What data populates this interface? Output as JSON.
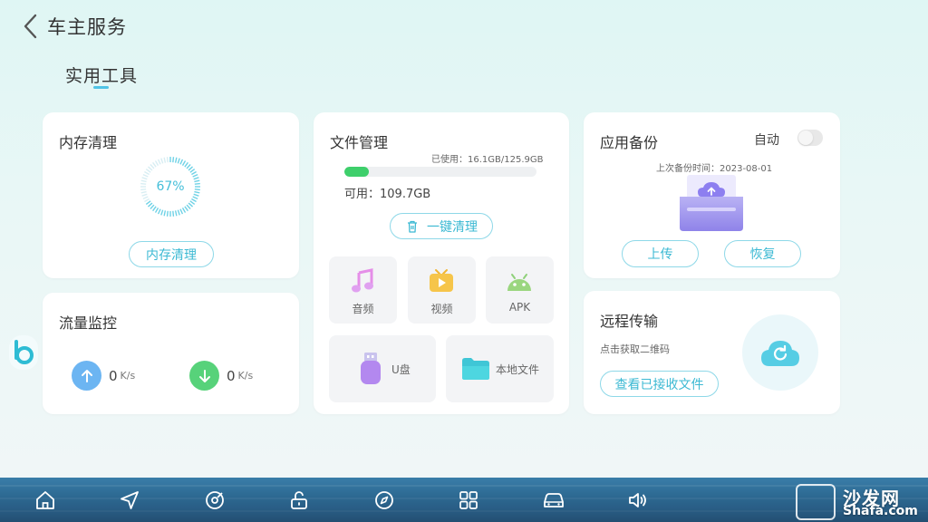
{
  "header": {
    "title": "车主服务",
    "back_icon": "chevron-left-icon"
  },
  "tab": {
    "label": "实用工具"
  },
  "memory": {
    "title": "内存清理",
    "percent_label": "67%",
    "percent": 0.67,
    "button": "内存清理"
  },
  "traffic": {
    "title": "流量监控",
    "upload": {
      "value": "0",
      "unit": "K/s",
      "icon": "upload-arrow-icon",
      "color": "#6cb5f2"
    },
    "download": {
      "value": "0",
      "unit": "K/s",
      "icon": "download-arrow-icon",
      "color": "#57d27a"
    }
  },
  "files": {
    "title": "文件管理",
    "used_text": "已使用：16.1GB/125.9GB",
    "used_fraction": 0.128,
    "available_text": "可用：109.7GB",
    "clean_button": "一键清理",
    "categories": [
      {
        "label": "音频",
        "icon": "music-note-icon"
      },
      {
        "label": "视频",
        "icon": "tv-video-icon"
      },
      {
        "label": "APK",
        "icon": "android-icon"
      }
    ],
    "storage": [
      {
        "label": "U盘",
        "icon": "usb-drive-icon"
      },
      {
        "label": "本地文件",
        "icon": "folder-icon"
      }
    ]
  },
  "backup": {
    "title": "应用备份",
    "auto_label": "自动",
    "auto_on": false,
    "last_backup": "上次备份时间：2023-08-01",
    "upload_button": "上传",
    "restore_button": "恢复"
  },
  "remote": {
    "title": "远程传输",
    "subtitle": "点击获取二维码",
    "button": "查看已接收文件"
  },
  "navbar": {
    "items": [
      {
        "icon": "home-icon"
      },
      {
        "icon": "navigation-arrow-icon"
      },
      {
        "icon": "music-disc-icon"
      },
      {
        "icon": "unlock-icon"
      },
      {
        "icon": "compass-icon"
      },
      {
        "icon": "apps-grid-icon"
      },
      {
        "icon": "car-icon"
      },
      {
        "icon": "volume-icon"
      }
    ]
  },
  "watermark": {
    "cn": "沙发网",
    "en": "Shafa.com"
  },
  "colors": {
    "accent": "#45bfd9",
    "green": "#3ecf6b",
    "card": "#ffffff"
  }
}
